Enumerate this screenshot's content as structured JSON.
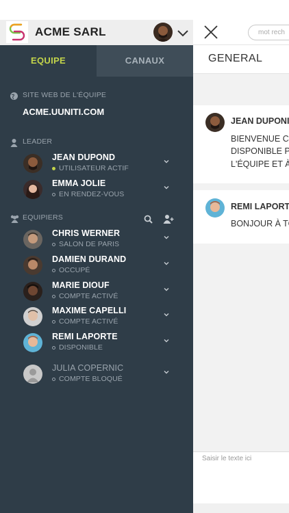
{
  "header": {
    "org_name": "ACME SARL"
  },
  "tabs": [
    {
      "label": "EQUIPE",
      "active": true
    },
    {
      "label": "CANAUX",
      "active": false
    }
  ],
  "site": {
    "label": "SITE WEB DE L'ÉQUIPE",
    "url": "ACME.UUNITI.COM"
  },
  "leader": {
    "label": "LEADER",
    "members": [
      {
        "name": "JEAN DUPOND",
        "status": "UTILISATEUR ACTIF",
        "active": true
      },
      {
        "name": "EMMA JOLIE",
        "status": "EN RENDEZ-VOUS",
        "active": false
      }
    ]
  },
  "team": {
    "label": "EQUIPIERS",
    "members": [
      {
        "name": "CHRIS WERNER",
        "status": "SALON DE PARIS"
      },
      {
        "name": "DAMIEN DURAND",
        "status": "OCCUPÉ"
      },
      {
        "name": "MARIE DIOUF",
        "status": "COMPTE ACTIVÉ"
      },
      {
        "name": "MAXIME CAPELLI",
        "status": "COMPTE ACTIVÉ"
      },
      {
        "name": "REMI LAPORTE",
        "status": "DISPONIBLE"
      },
      {
        "name": "JULIA COPERNIC",
        "status": "COMPTE BLOQUÉ",
        "blocked": true
      }
    ]
  },
  "chat": {
    "search_placeholder": "mot rech",
    "channel_title": "GENERAL",
    "messages": [
      {
        "author": "JEAN DUPONI",
        "lines": [
          "BIENVENUE CI",
          "DISPONIBLE P",
          "L'ÉQUIPE ET À"
        ]
      },
      {
        "author": "REMI LAPORT",
        "lines": [
          "BONJOUR À TO"
        ]
      }
    ],
    "compose_placeholder": "Saisir le texte ici"
  },
  "colors": {
    "drawer_bg": "#2f3d48",
    "accent": "#c3d44a",
    "muted_text": "#9aa4ad"
  }
}
